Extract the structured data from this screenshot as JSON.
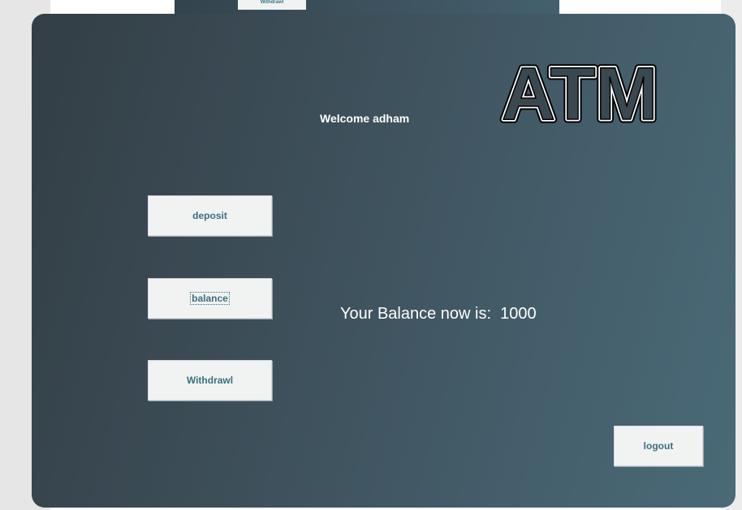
{
  "background": {
    "peek_button_label": "Withdrawl"
  },
  "header": {
    "logo_text": "ATM",
    "welcome_text": "Welcome adham"
  },
  "menu": {
    "deposit_label": "deposit",
    "balance_label": "balance",
    "withdraw_label": "Withdrawl"
  },
  "balance": {
    "label": "Your Balance now is:",
    "value": "1000"
  },
  "footer": {
    "logout_label": "logout"
  },
  "colors": {
    "panel_dark": "#333e45",
    "panel_light": "#4a6a78",
    "button_bg": "#f1f3f3",
    "button_text": "#3b6f80"
  }
}
